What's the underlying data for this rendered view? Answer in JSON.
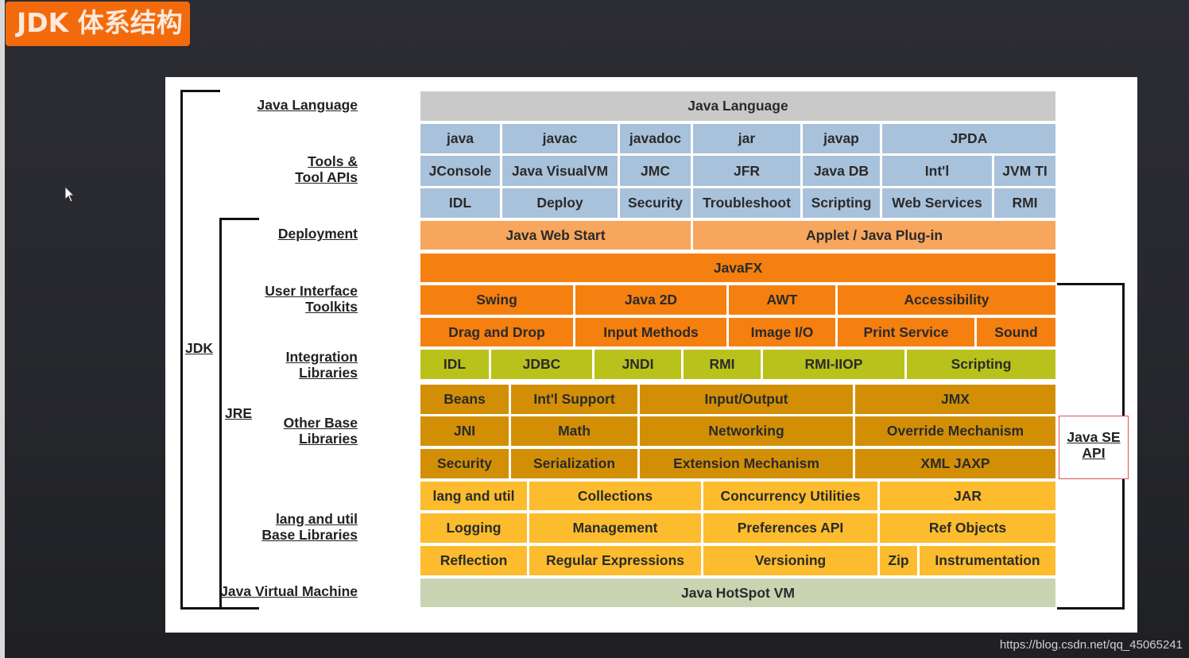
{
  "title": "JDK 体系结构",
  "watermark": "https://blog.csdn.net/qq_45065241",
  "colors": {
    "language": "#c9c9c9",
    "tools": "#a9c2dc",
    "deployment": "#f7a65e",
    "ui": "#f57f0f",
    "integration": "#b8c21b",
    "other_base": "#d28f06",
    "lang_util": "#fcbc2e",
    "vm": "#c9d4b2",
    "title_bg": "#f26a0b"
  },
  "left_labels": {
    "java_language": "Java Language",
    "tools_1": "Tools &",
    "tools_2": "Tool APIs",
    "deployment": "Deployment",
    "ui_1": "User Interface",
    "ui_2": "Toolkits",
    "integration_1": "Integration",
    "integration_2": "Libraries",
    "other_1": "Other Base",
    "other_2": "Libraries",
    "lang_1": "lang and util",
    "lang_2": "Base Libraries",
    "jvm": "Java Virtual Machine"
  },
  "brackets": {
    "jdk": "JDK",
    "jre": "JRE",
    "java_se_api_1": "Java SE",
    "java_se_api_2": "API"
  },
  "rows": [
    {
      "group": "language",
      "cells": [
        "Java Language"
      ]
    },
    {
      "group": "tools",
      "cells": [
        "java",
        "javac",
        "javadoc",
        "jar",
        "javap",
        "JPDA"
      ]
    },
    {
      "group": "tools",
      "cells": [
        "JConsole",
        "Java VisualVM",
        "JMC",
        "JFR",
        "Java DB",
        "Int'l",
        "JVM TI"
      ]
    },
    {
      "group": "tools",
      "cells": [
        "IDL",
        "Deploy",
        "Security",
        "Troubleshoot",
        "Scripting",
        "Web Services",
        "RMI"
      ]
    },
    {
      "group": "deployment",
      "cells": [
        "Java Web Start",
        "Applet / Java Plug-in"
      ]
    },
    {
      "group": "ui",
      "cells": [
        "JavaFX"
      ]
    },
    {
      "group": "ui",
      "cells": [
        "Swing",
        "Java 2D",
        "AWT",
        "Accessibility"
      ]
    },
    {
      "group": "ui",
      "cells": [
        "Drag and Drop",
        "Input Methods",
        "Image I/O",
        "Print Service",
        "Sound"
      ]
    },
    {
      "group": "integration",
      "cells": [
        "IDL",
        "JDBC",
        "JNDI",
        "RMI",
        "RMI-IIOP",
        "Scripting"
      ]
    },
    {
      "group": "other_base",
      "cells": [
        "Beans",
        "Int'l Support",
        "Input/Output",
        "JMX"
      ]
    },
    {
      "group": "other_base",
      "cells": [
        "JNI",
        "Math",
        "Networking",
        "Override Mechanism"
      ]
    },
    {
      "group": "other_base",
      "cells": [
        "Security",
        "Serialization",
        "Extension Mechanism",
        "XML JAXP"
      ]
    },
    {
      "group": "lang_util",
      "cells": [
        "lang and util",
        "Collections",
        "Concurrency Utilities",
        "JAR"
      ]
    },
    {
      "group": "lang_util",
      "cells": [
        "Logging",
        "Management",
        "Preferences API",
        "Ref Objects"
      ]
    },
    {
      "group": "lang_util",
      "cells": [
        "Reflection",
        "Regular Expressions",
        "Versioning",
        "Zip",
        "Instrumentation"
      ]
    },
    {
      "group": "vm",
      "cells": [
        "Java HotSpot VM"
      ]
    }
  ]
}
